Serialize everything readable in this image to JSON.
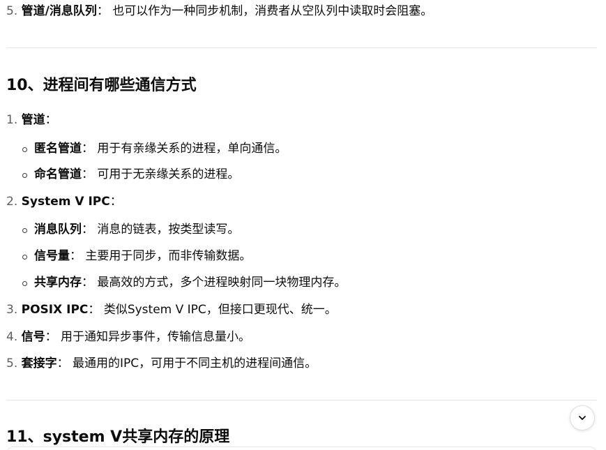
{
  "prev": {
    "num": "5.",
    "term": "管道/消息队列",
    "sep": "：",
    "desc": "也可以作为一种同步机制，消费者从空队列中读取时会阻塞。"
  },
  "section10": {
    "title": "10、进程间有哪些通信方式",
    "items": [
      {
        "num": "1.",
        "term": "管道",
        "sep": "：",
        "desc": "",
        "subs": [
          {
            "term": "匿名管道",
            "sep": "：",
            "desc": "用于有亲缘关系的进程，单向通信。"
          },
          {
            "term": "命名管道",
            "sep": "：",
            "desc": "可用于无亲缘关系的进程。"
          }
        ]
      },
      {
        "num": "2.",
        "term": "System V IPC",
        "sep": "：",
        "desc": "",
        "subs": [
          {
            "term": "消息队列",
            "sep": "：",
            "desc": "消息的链表，按类型读写。"
          },
          {
            "term": "信号量",
            "sep": "：",
            "desc": "主要用于同步，而非传输数据。"
          },
          {
            "term": "共享内存",
            "sep": "：",
            "desc": "最高效的方式，多个进程映射同一块物理内存。"
          }
        ]
      },
      {
        "num": "3.",
        "term": "POSIX IPC",
        "sep": "：",
        "desc": "类似System V IPC，但接口更现代、统一。"
      },
      {
        "num": "4.",
        "term": "信号",
        "sep": "：",
        "desc": "用于通知异步事件，传输信息量小。"
      },
      {
        "num": "5.",
        "term": "套接字",
        "sep": "：",
        "desc": "最通用的IPC，可用于不同主机的进程间通信。"
      }
    ]
  },
  "section11": {
    "title": "11、system V共享内存的原理"
  },
  "scroll_button": {
    "icon": "chevron-down-icon"
  }
}
